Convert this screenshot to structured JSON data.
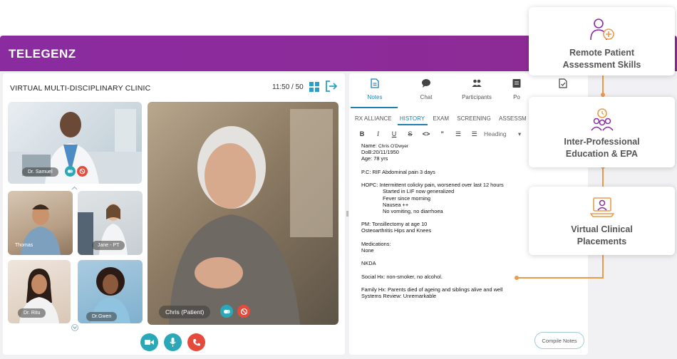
{
  "app": {
    "logo": "TELEGENZ"
  },
  "header": {
    "title": "VIRTUAL MULTI-DISCIPLINARY CLINIC",
    "timer": "11:50 / 50"
  },
  "participants": {
    "samuel": "Dr. Samuel",
    "thomas": "Thomas",
    "jane": "Jane - PT",
    "ritu": "Dr. Ritu",
    "gwen": "Dr.Gwen",
    "patient": "Chris (Patient)"
  },
  "tabs": [
    {
      "label": "Notes",
      "icon": "notes-icon"
    },
    {
      "label": "Chat",
      "icon": "chat-icon"
    },
    {
      "label": "Participants",
      "icon": "participants-icon"
    },
    {
      "label": "Po",
      "icon": "document-icon"
    },
    {
      "label": "",
      "icon": "checklist-icon"
    }
  ],
  "sub_tabs": [
    "RX ALLIANCE",
    "HISTORY",
    "EXAM",
    "SCREENING",
    "ASSESSM"
  ],
  "toolbar": {
    "bold": "B",
    "italic": "I",
    "underline": "U",
    "strike": "S",
    "code": "<>",
    "quote": "”",
    "ol": "☰",
    "ul": "☰",
    "heading": "Heading",
    "caret": "▾"
  },
  "notes": {
    "name_label": "Name:",
    "name_value": "Chris O'Dwyer",
    "dob": "DoB:20/11/1950",
    "age": "Age: 78 yrs",
    "pc": "P.C: RIF Abdominal pain 3 days",
    "hopc1": "HOPC: Intermittent colicky pain, worsened over last 12 hours",
    "hopc2": "Started in LIF now generalized",
    "hopc3": "Fever since morning",
    "hopc4": "Nausea ++",
    "hopc5": "No vomiting, no diarrhoea",
    "pm1": "PM: Tonsillectomy at age 10",
    "pm2": "Osteoarthritis Hips and Knees",
    "med1": "Medications:",
    "med2": "None",
    "nkda": "NKDA",
    "social": "Social Hx: non-smoker, no alcohol.",
    "family": "Family Hx: Parents died of ageing and siblings alive and well",
    "systems": "Systems Review: Unremarkable"
  },
  "compile_button": "Compile Notes",
  "feature_cards": [
    {
      "line1": "Remote Patient",
      "line2": "Assessment Skills"
    },
    {
      "line1": "Inter-Professional",
      "line2": "Education & EPA"
    },
    {
      "line1": "Virtual Clinical",
      "line2": "Placements"
    }
  ],
  "colors": {
    "brand": "#8a2ba0",
    "accent": "#1e7fb0",
    "teal": "#2aa8b8",
    "end_call": "#e64a3b",
    "connector": "#e99b4d"
  }
}
